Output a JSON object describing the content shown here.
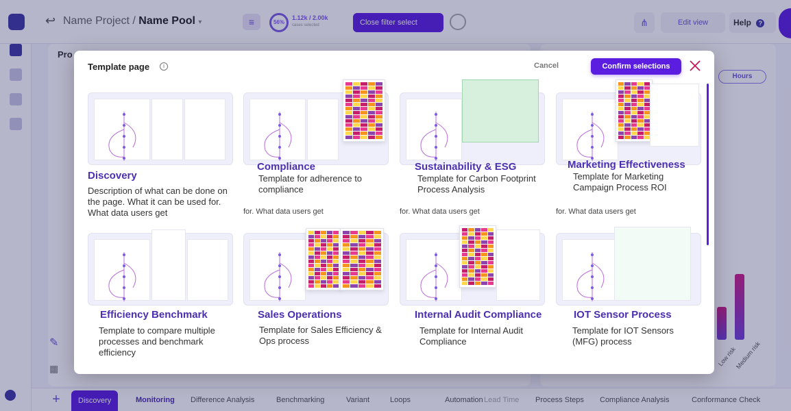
{
  "topbar": {
    "project": "Name Project",
    "separator": "/",
    "pool": "Name Pool",
    "ring_value": "56%",
    "count_text": "1.12k / 2.00k",
    "count_sub": "cases selected",
    "close_filter_label": "Close filter select",
    "edit_view_label": "Edit view",
    "help_label": "Help",
    "help_glyph": "?"
  },
  "background": {
    "panel_title": "Pro",
    "hours_label": "Hours",
    "bar_labels": [
      "Low risk",
      "Medium risk"
    ],
    "bar_values": [
      0.3,
      0.6
    ]
  },
  "bottom_tabs": {
    "active": "Discovery",
    "items": [
      "Monitoring",
      "Difference Analysis",
      "Benchmarking",
      "Variant",
      "Loops",
      "Automation",
      "Lead Time",
      "Process Steps",
      "Compliance Analysis",
      "Conformance Check"
    ]
  },
  "modal": {
    "title": "Template page",
    "info_glyph": "i",
    "cancel_label": "Cancel",
    "confirm_label": "Confirm selections",
    "cards": [
      {
        "title": "Discovery",
        "desc": "Description of what can be done on the page. What it can be used for. What data users get",
        "ghost": ""
      },
      {
        "title": "Compliance",
        "desc": "Template for adherence to compliance",
        "ghost": "for. What data users get"
      },
      {
        "title": "Sustainability & ESG",
        "desc": "Template for Carbon Footprint Process Analysis",
        "ghost": "for. What data users get"
      },
      {
        "title": "Marketing Effectiveness",
        "desc": "Template for Marketing Campaign Process ROI",
        "ghost": "for. What data users get"
      },
      {
        "title": "Efficiency Benchmark",
        "desc": "Template to compare multiple processes and benchmark efficiency",
        "ghost": ""
      },
      {
        "title": "Sales Operations",
        "desc": "Template for Sales Efficiency & Ops  process",
        "ghost": ""
      },
      {
        "title": "Internal Audit Compliance",
        "desc": "Template for Internal Audit Compliance",
        "ghost": ""
      },
      {
        "title": "IOT Sensor Process",
        "desc": "Template for IOT Sensors (MFG)  process",
        "ghost": ""
      }
    ]
  },
  "colors": {
    "primary": "#5b1ee0",
    "title_purple": "#4b2fb0",
    "close_red": "#c2185b",
    "heat_palette": [
      "#e73b8f",
      "#f7941d",
      "#ffd84d",
      "#8e44ad",
      "#c51f6b"
    ]
  }
}
